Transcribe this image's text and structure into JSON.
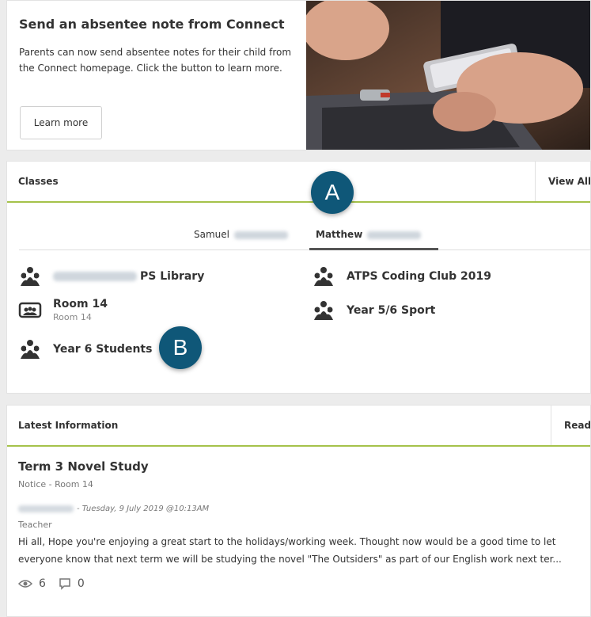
{
  "promo": {
    "title": "Send an absentee note from Connect",
    "body": "Parents can now send absentee notes for their child from the Connect homepage. Click the button to learn more.",
    "button_label": "Learn more"
  },
  "classes": {
    "title": "Classes",
    "action_label": "View All",
    "tabs": [
      {
        "label": "Samuel",
        "active": false
      },
      {
        "label": "Matthew",
        "active": true
      }
    ],
    "items": [
      {
        "name": "PS Library",
        "sub": "",
        "icon": "students-group-icon"
      },
      {
        "name": "ATPS Coding Club 2019",
        "sub": "",
        "icon": "students-group-icon"
      },
      {
        "name": "Room 14",
        "sub": "Room 14",
        "icon": "classroom-icon"
      },
      {
        "name": "Year 5/6 Sport",
        "sub": "",
        "icon": "students-group-icon"
      },
      {
        "name": "Year 6 Students",
        "sub": "",
        "icon": "students-group-icon"
      }
    ]
  },
  "latest": {
    "title": "Latest Information",
    "action_label": "Read",
    "post": {
      "title": "Term 3 Novel Study",
      "meta": "Notice - Room 14",
      "date": "- Tuesday, 9 July 2019 @10:13AM",
      "role": "Teacher",
      "body": "Hi all, Hope you're enjoying a great start to the holidays/working week. Thought now would be a good time to let everyone know that next term we will be studying the novel \"The Outsiders\" as part of our English work next ter...",
      "views": "6",
      "comments": "0"
    }
  },
  "callouts": {
    "a": "A",
    "b": "B"
  },
  "colors": {
    "accent_line": "#a5c24a",
    "badge": "#0f5778"
  }
}
